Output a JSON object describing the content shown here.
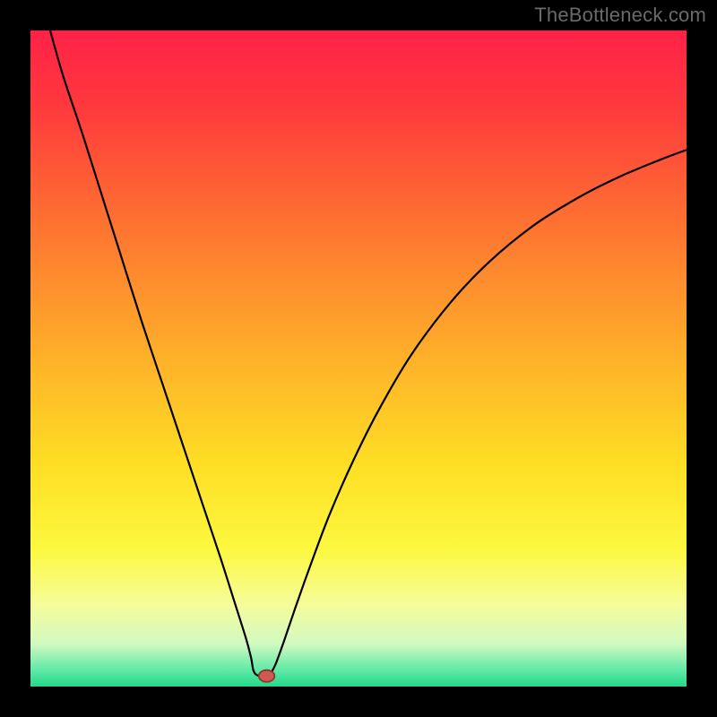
{
  "watermark": "TheBottleneck.com",
  "colors": {
    "black": "#000000",
    "line": "#000000",
    "marker_fill": "#cf5a51",
    "marker_stroke": "#8c3832"
  },
  "chart_data": {
    "type": "line",
    "title": "",
    "xlabel": "",
    "ylabel": "",
    "xlim": [
      0,
      100
    ],
    "ylim": [
      0,
      100
    ],
    "gradient_stops": [
      {
        "offset": 0.0,
        "color": "#ff2247"
      },
      {
        "offset": 0.12,
        "color": "#ff3a3d"
      },
      {
        "offset": 0.3,
        "color": "#fe7431"
      },
      {
        "offset": 0.5,
        "color": "#feb129"
      },
      {
        "offset": 0.66,
        "color": "#fede24"
      },
      {
        "offset": 0.79,
        "color": "#fcf83f"
      },
      {
        "offset": 0.875,
        "color": "#f6fc9a"
      },
      {
        "offset": 0.935,
        "color": "#d1f9c1"
      },
      {
        "offset": 0.975,
        "color": "#5fe9a6"
      },
      {
        "offset": 1.0,
        "color": "#23d989"
      }
    ],
    "series": [
      {
        "name": "curve",
        "x": [
          3,
          5,
          8,
          11,
          14,
          17,
          20,
          23,
          26,
          29,
          31,
          32.8,
          33.6,
          34.0,
          34.6,
          35.4,
          36.0,
          36.6,
          37.4,
          38.6,
          40.2,
          42.5,
          45.5,
          49,
          53,
          58,
          64,
          70,
          77,
          84,
          90,
          96,
          100
        ],
        "y": [
          100,
          93,
          84,
          74.5,
          65,
          55.5,
          46.5,
          37.5,
          28.5,
          19.5,
          13.2,
          7.5,
          4.5,
          2.4,
          1.7,
          1.6,
          1.6,
          2.0,
          3.5,
          6.8,
          11.5,
          18.0,
          26.0,
          34.0,
          42.0,
          50.5,
          58.5,
          64.8,
          70.5,
          74.8,
          77.8,
          80.3,
          81.8
        ]
      }
    ],
    "marker": {
      "x": 36.0,
      "y": 1.6,
      "rx": 1.2,
      "ry": 0.9
    }
  }
}
